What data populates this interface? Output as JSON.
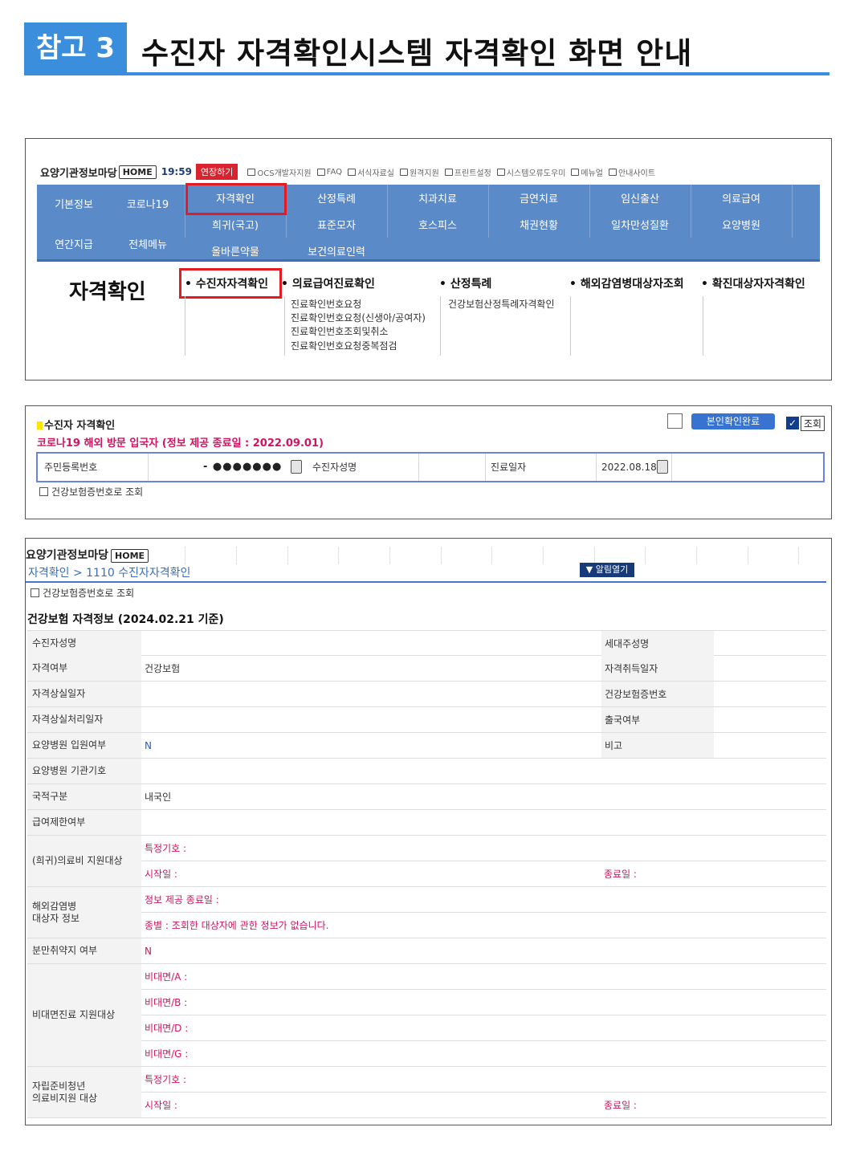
{
  "header": {
    "badge": "참고 3",
    "title": "수진자 자격확인시스템 자격확인 화면 안내"
  },
  "panel1": {
    "brand": "요양기관정보마당",
    "home": "HOME",
    "clock": "19:59",
    "extend": "연장하기",
    "toplinks": [
      "OCS개발자지원",
      "FAQ",
      "서식자료실",
      "원격지원",
      "프린트설정",
      "시스템오류도우미",
      "메뉴얼",
      "안내사이트"
    ],
    "menu": {
      "left": [
        "기본정보",
        "코로나19",
        "연간지급",
        "전체메뉴"
      ],
      "row1": [
        "자격확인",
        "산정특례",
        "치과치료",
        "금연치료",
        "임신출산",
        "의료급여"
      ],
      "row2": [
        "희귀(국고)",
        "표준모자",
        "호스피스",
        "채권현황",
        "일차만성질환",
        "요양병원"
      ],
      "row3": [
        "올바른약물",
        "보건의료인력"
      ]
    },
    "sub": {
      "title": "자격확인",
      "col1": "• 수진자자격확인",
      "col2": "• 의료급여진료확인",
      "col2_items": [
        "진료확인번호요청",
        "진료확인번호요청(신생아/공여자)",
        "진료확인번호조회및취소",
        "진료확인번호요청중복점검"
      ],
      "col3": "• 산정특례",
      "col3_items": [
        "건강보험산정특례자격확인"
      ],
      "col4": "• 해외감염병대상자조회",
      "col5": "• 확진대상자자격확인"
    }
  },
  "panel2": {
    "title": "수진자 자격확인",
    "alert": "코로나19 해외 방문 입국자 (정보 제공 종료일 : 2022.09.01)",
    "confirm_btn": "본인확인완료",
    "query_label": "조회",
    "form": {
      "rrn_label": "주민등록번호",
      "rrn_mask": "- ●●●●●●●",
      "name_label": "수진자성명",
      "date_label": "진료일자",
      "date_value": "2022.08.18"
    },
    "cardno_check": "건강보험증번호로 조회"
  },
  "panel3": {
    "brand": "요양기관정보마당",
    "home": "HOME",
    "breadcrumb": "자격확인 > 1110 수진자자격확인",
    "notice_btn": "▼ 알림열기",
    "cardno_check": "건강보험증번호로 조회",
    "section": "건강보험 자격정보 (2024.02.21 기준)",
    "rows": {
      "r1": {
        "label": "수진자성명",
        "value": "",
        "label2": "세대주성명",
        "value2": ""
      },
      "r2": {
        "label": "자격여부",
        "value": "건강보험",
        "label2": "자격취득일자",
        "value2": ""
      },
      "r3": {
        "label": "자격상실일자",
        "value": "",
        "label2": "건강보험증번호",
        "value2": ""
      },
      "r4": {
        "label": "자격상실처리일자",
        "value": "",
        "label2": "출국여부",
        "value2": ""
      },
      "r5": {
        "label": "요양병원 입원여부",
        "value": "N",
        "label2": "비고",
        "value2": ""
      },
      "r6": {
        "label": "요양병원 기관기호",
        "value": ""
      },
      "r7": {
        "label": "국적구분",
        "value": "내국인"
      },
      "r8": {
        "label": "급여제한여부",
        "value": ""
      },
      "r9": {
        "label": "(희귀)의료비 지원대상",
        "code": "특정기호 :",
        "start": "시작일 :",
        "end": "종료일 :"
      },
      "r10": {
        "label1": "해외감염병",
        "label2": "대상자 정보",
        "line1": "정보 제공 종료일 :",
        "line2": "종별 : 조회한 대상자에 관한 정보가 없습니다."
      },
      "r11": {
        "label": "분만취약지 여부",
        "value": "N"
      },
      "r12": {
        "label": "비대면진료 지원대상",
        "a": "비대면/A :",
        "b": "비대면/B :",
        "d": "비대면/D :",
        "g": "비대면/G :"
      },
      "r13": {
        "label1": "자립준비청년",
        "label2": "의료비지원 대상",
        "code": "특정기호 :",
        "start": "시작일 :",
        "end": "종료일 :"
      }
    }
  }
}
